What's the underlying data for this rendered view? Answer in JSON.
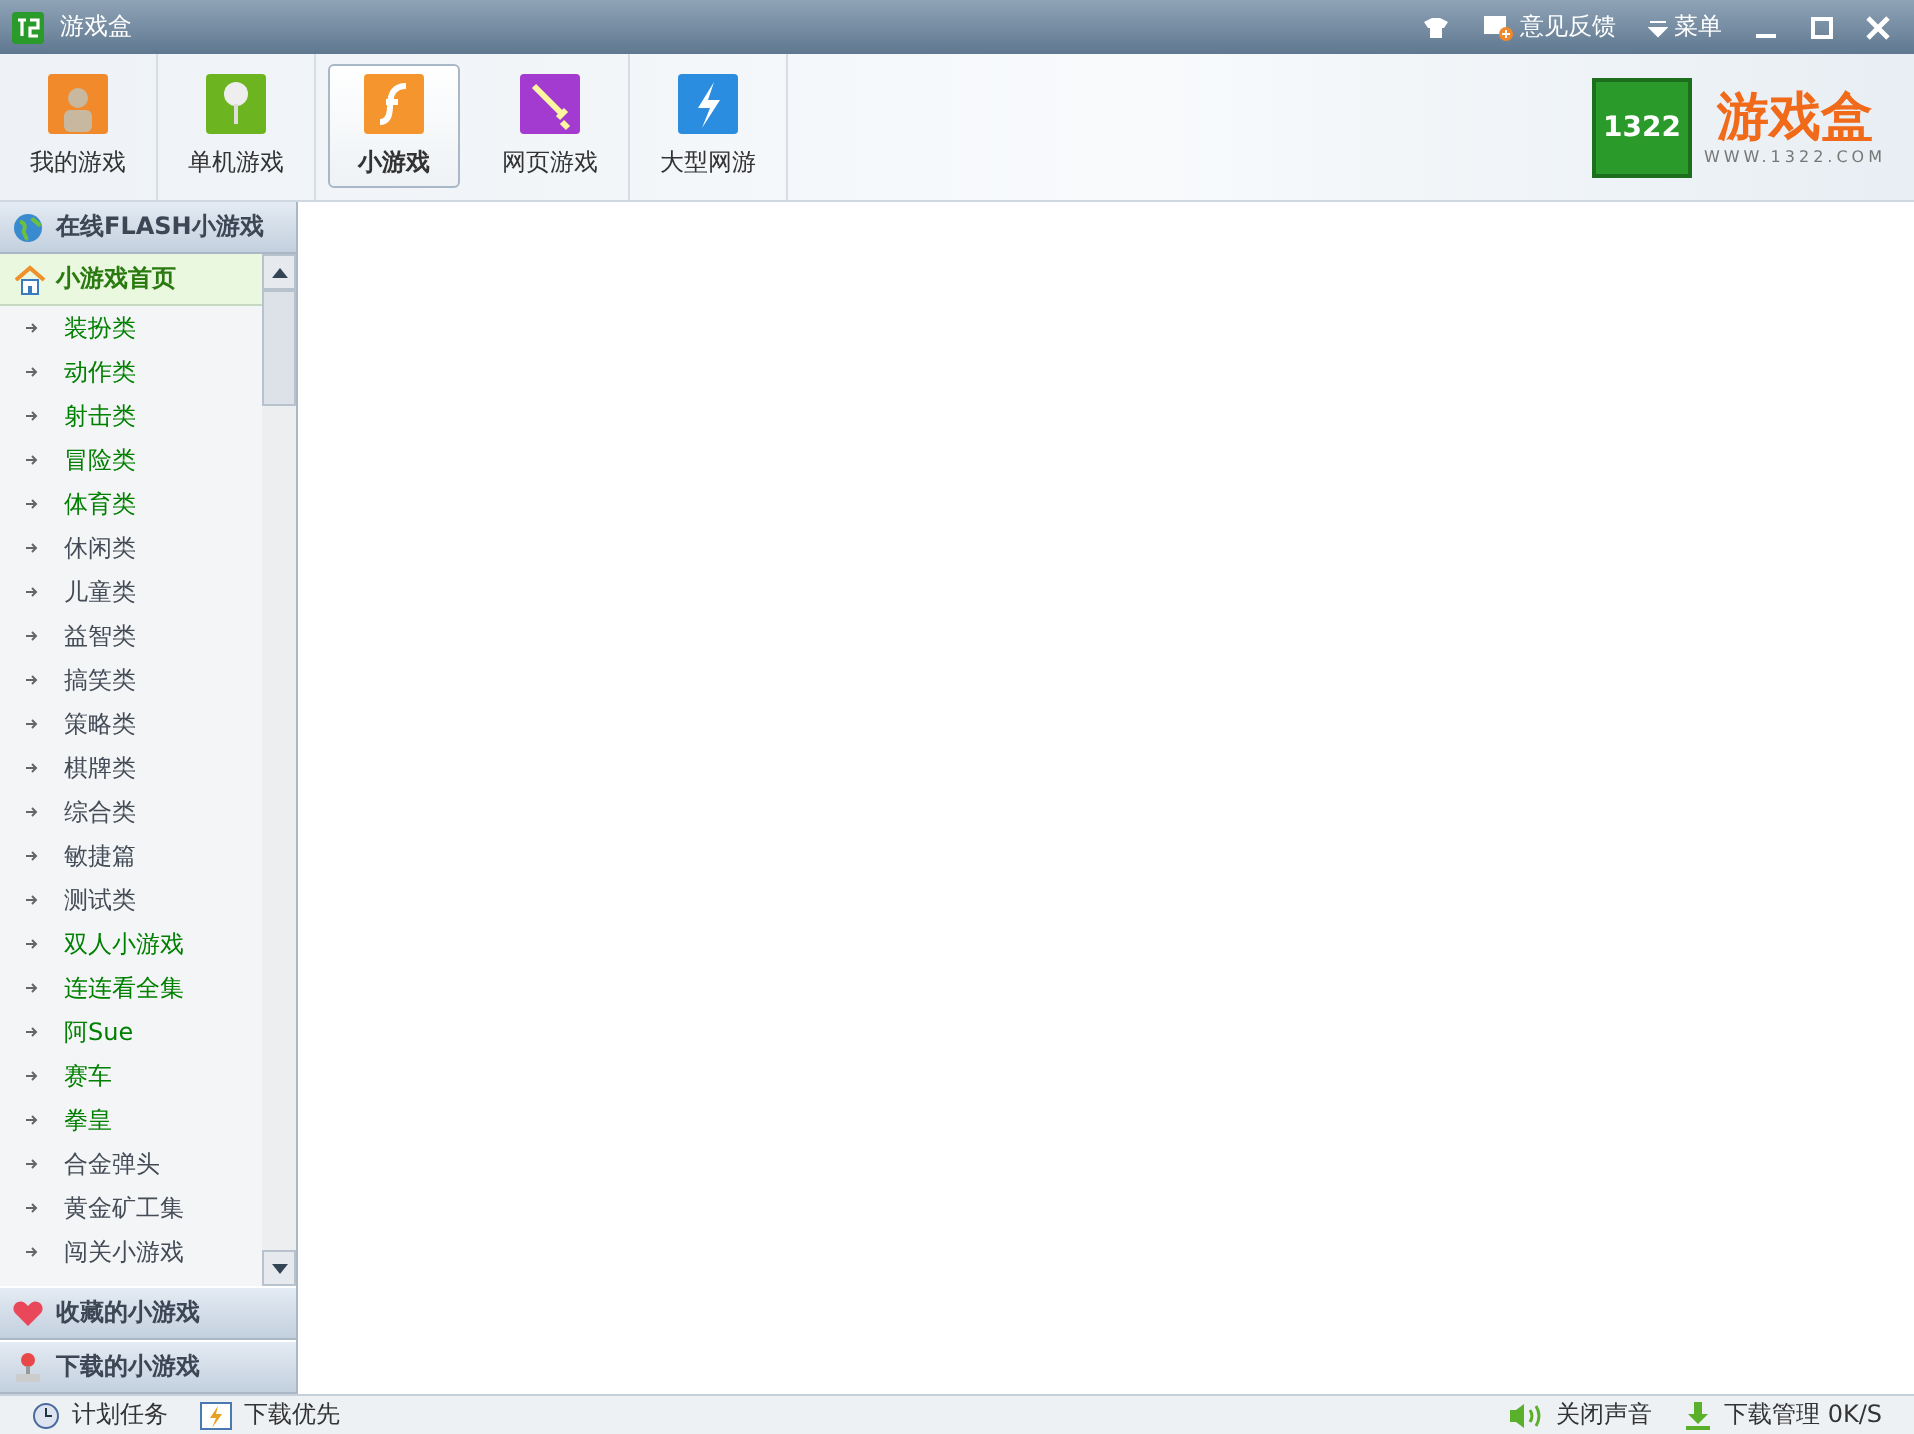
{
  "window": {
    "title": "游戏盒",
    "controls": [
      "意见反馈",
      "菜单"
    ]
  },
  "tabs": [
    {
      "label": "我的游戏",
      "kind": "person",
      "selected": false
    },
    {
      "label": "单机游戏",
      "kind": "pin",
      "selected": false
    },
    {
      "label": "小游戏",
      "kind": "flash",
      "selected": true
    },
    {
      "label": "网页游戏",
      "kind": "sword",
      "selected": false
    },
    {
      "label": "大型网游",
      "kind": "bolt",
      "selected": false
    }
  ],
  "logo": {
    "mark": "1322",
    "name": "游戏盒",
    "url": "WWW.1322.COM"
  },
  "sidebar": {
    "header": "在线FLASH小游戏",
    "home": {
      "label": "小游戏首页",
      "selected": true
    },
    "items": [
      {
        "label": "装扮类",
        "color": "#008000"
      },
      {
        "label": "动作类",
        "color": "#008000"
      },
      {
        "label": "射击类",
        "color": "#008000"
      },
      {
        "label": "冒险类",
        "color": "#008000"
      },
      {
        "label": "体育类",
        "color": "#008000"
      },
      {
        "label": "休闲类",
        "color": "#444c58"
      },
      {
        "label": "儿童类",
        "color": "#444c58"
      },
      {
        "label": "益智类",
        "color": "#444c58"
      },
      {
        "label": "搞笑类",
        "color": "#444c58"
      },
      {
        "label": "策略类",
        "color": "#444c58"
      },
      {
        "label": "棋牌类",
        "color": "#444c58"
      },
      {
        "label": "综合类",
        "color": "#444c58"
      },
      {
        "label": "敏捷篇",
        "color": "#444c58"
      },
      {
        "label": "测试类",
        "color": "#444c58"
      },
      {
        "label": "双人小游戏",
        "color": "#008000"
      },
      {
        "label": "连连看全集",
        "color": "#008000"
      },
      {
        "label": "阿Sue",
        "color": "#008000"
      },
      {
        "label": "赛车",
        "color": "#008000"
      },
      {
        "label": "拳皇",
        "color": "#008000"
      },
      {
        "label": "合金弹头",
        "color": "#444c58"
      },
      {
        "label": "黄金矿工集",
        "color": "#444c58"
      },
      {
        "label": "闯关小游戏",
        "color": "#444c58"
      }
    ],
    "sections": [
      {
        "label": "收藏的小游戏",
        "kind": "heart"
      },
      {
        "label": "下载的小游戏",
        "kind": "joystick"
      }
    ]
  },
  "status_bar": {
    "left": [
      {
        "label": "计划任务",
        "kind": "clock"
      },
      {
        "label": "下载优先",
        "kind": "bolt"
      }
    ],
    "right": [
      {
        "label": "关闭声音",
        "kind": "speaker"
      },
      {
        "label": "下载管理 0K/S",
        "kind": "download"
      }
    ]
  }
}
